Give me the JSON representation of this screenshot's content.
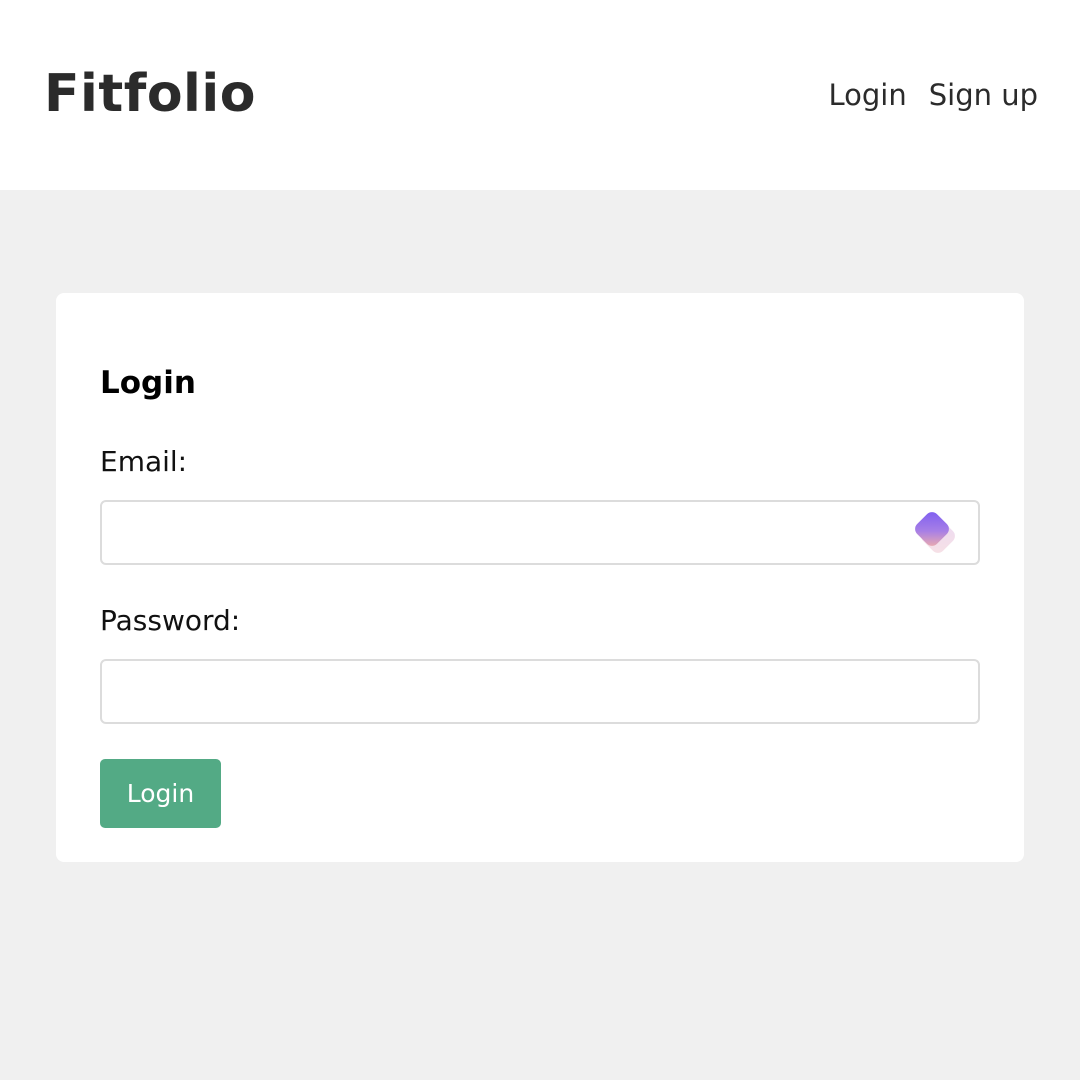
{
  "header": {
    "logo": "Fitfolio",
    "nav": {
      "login": "Login",
      "signup": "Sign up"
    }
  },
  "form": {
    "title": "Login",
    "email_label": "Email:",
    "email_value": "",
    "password_label": "Password:",
    "password_value": "",
    "submit_label": "Login",
    "email_field_icon": "password-manager-extension-icon"
  },
  "colors": {
    "page_background": "#f0f0f0",
    "header_background": "#ffffff",
    "card_background": "#ffffff",
    "button_background": "#53aa85",
    "button_text": "#ffffff",
    "input_border": "#dcdcdc",
    "text": "#2b2b2b"
  }
}
